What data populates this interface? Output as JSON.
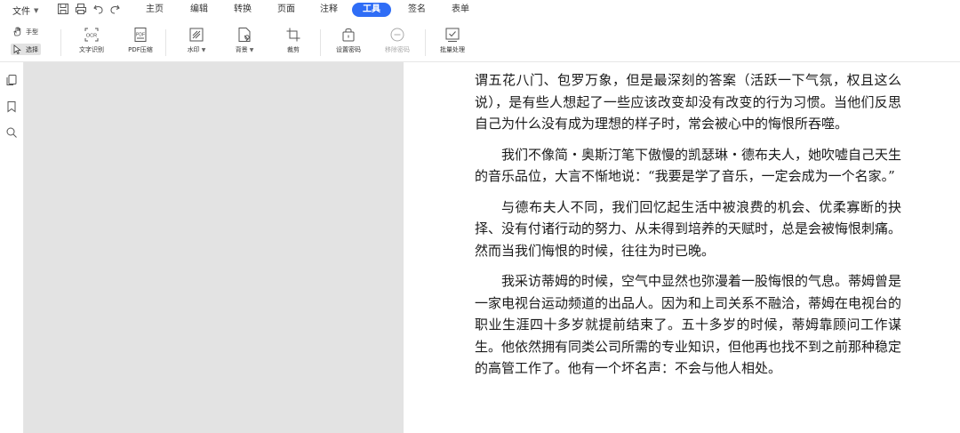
{
  "menubar": {
    "file_label": "文件",
    "tabs": [
      {
        "label": "主页"
      },
      {
        "label": "编辑"
      },
      {
        "label": "转换"
      },
      {
        "label": "页面"
      },
      {
        "label": "注释"
      },
      {
        "label": "工具",
        "active": true
      },
      {
        "label": "签名"
      },
      {
        "label": "表单"
      }
    ],
    "quick_icons": [
      "save-icon",
      "print-icon",
      "undo-icon",
      "redo-icon"
    ]
  },
  "ribbon": {
    "hand_label": "手型",
    "select_label": "选择",
    "tools": {
      "ocr": "文字识别",
      "compress": "PDF压缩",
      "watermark": "水印",
      "background": "背景",
      "crop": "裁剪",
      "set_password": "设置密码",
      "remove_password": "移除密码",
      "batch": "批量处理"
    },
    "ocr_icon_text": "OCR",
    "pdf_icon_text": "PDF"
  },
  "sidebar": {
    "icons": [
      "pages-icon",
      "bookmark-icon",
      "search-icon"
    ]
  },
  "document": {
    "paragraphs": [
      "谓五花八门、包罗万象，但是最深刻的答案（活跃一下气氛，权且这么说），是有些人想起了一些应该改变却没有改变的行为习惯。当他们反思自己为什么没有成为理想的样子时，常会被心中的悔恨所吞噬。",
      "我们不像简・奥斯汀笔下傲慢的凯瑟琳・德布夫人，她吹嘘自己天生的音乐品位，大言不惭地说：“我要是学了音乐，一定会成为一个名家。”",
      "与德布夫人不同，我们回忆起生活中被浪费的机会、优柔寡断的抉择、没有付诸行动的努力、从未得到培养的天赋时，总是会被悔恨刺痛。然而当我们悔恨的时候，往往为时已晚。",
      "我采访蒂姆的时候，空气中显然也弥漫着一股悔恨的气息。蒂姆曾是一家电视台运动频道的出品人。因为和上司关系不融洽，蒂姆在电视台的职业生涯四十多岁就提前结束了。五十多岁的时候，蒂姆靠顾问工作谋生。他依然拥有同类公司所需的专业知识，但他再也找不到之前那种稳定的高管工作了。他有一个坏名声：不会与他人相处。"
    ]
  }
}
